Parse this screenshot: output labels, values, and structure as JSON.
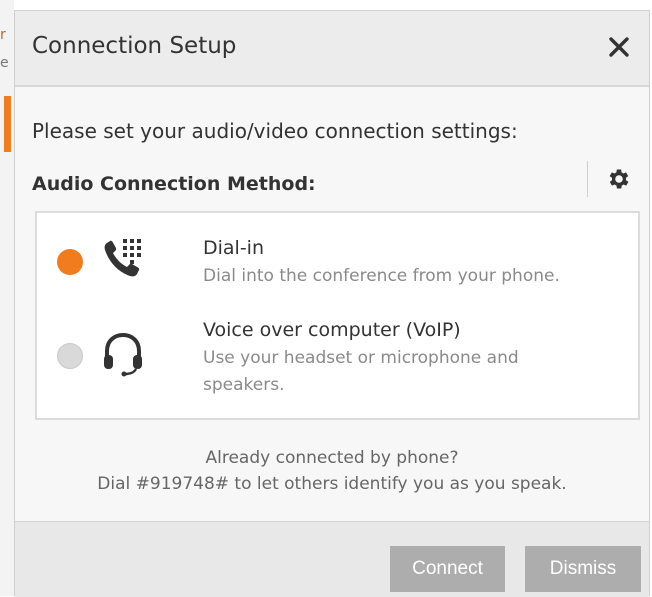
{
  "background": {
    "edge_chars": [
      "r",
      "e"
    ],
    "accent_color": "#f07c1e"
  },
  "dialog": {
    "title": "Connection Setup",
    "close_icon": "close-icon",
    "intro_text": "Please set your audio/video connection settings:",
    "method_label": "Audio Connection Method:",
    "settings_icon": "gear-icon",
    "options": [
      {
        "id": "dial-in",
        "selected": true,
        "icon": "phone-keypad-icon",
        "title": "Dial-in",
        "description": "Dial into the conference from your phone."
      },
      {
        "id": "voip",
        "selected": false,
        "icon": "headset-icon",
        "title": "Voice over computer (VoIP)",
        "description_line1": "Use your headset or microphone and",
        "description_line2": "speakers."
      }
    ],
    "phone_note_line1": "Already connected by phone?",
    "phone_note_line2": "Dial #919748# to let others identify you as you speak.",
    "buttons": {
      "connect": "Connect",
      "dismiss": "Dismiss"
    }
  },
  "colors": {
    "accent": "#f07c1e",
    "button_bg": "#adadad",
    "text_dark": "#333333",
    "text_muted": "#8a8a8a"
  }
}
